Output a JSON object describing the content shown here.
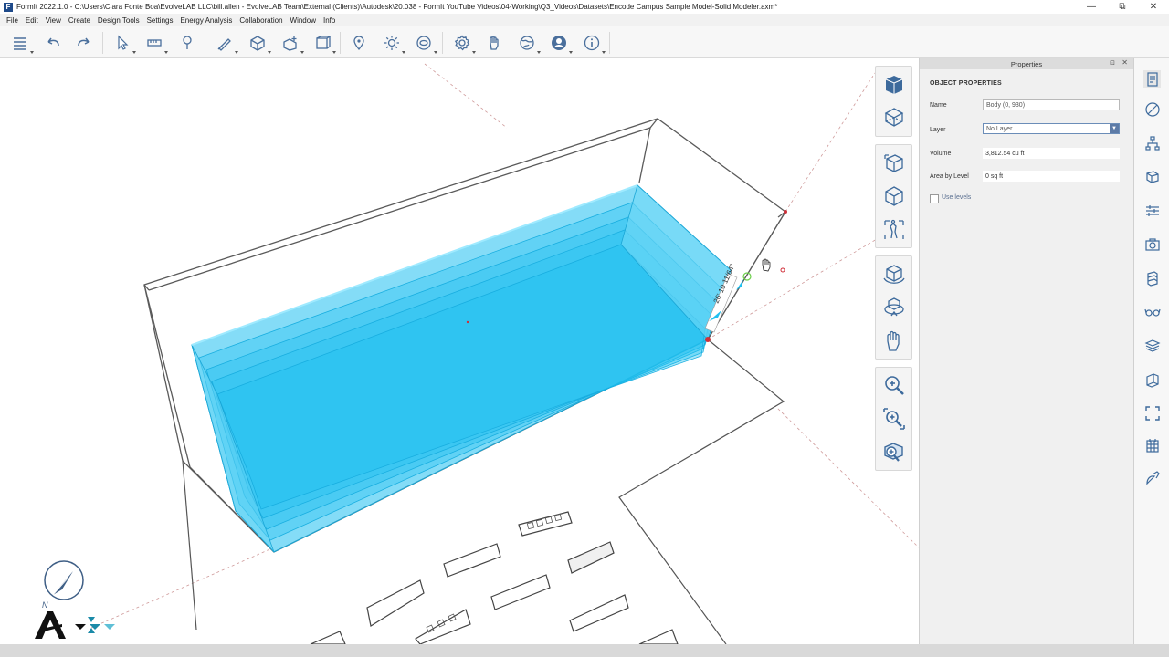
{
  "window": {
    "title": "FormIt 2022.1.0 - C:\\Users\\Clara Fonte Boa\\EvolveLAB LLC\\bill.allen - EvolveLAB Team\\External (Clients)\\Autodesk\\20.038 - FormIt YouTube Videos\\04-Working\\Q3_Videos\\Datasets\\Encode Campus Sample Model-Solid Modeler.axm*",
    "logo_letter": "F",
    "minimize_glyph": "—",
    "maximize_glyph": "⧉",
    "close_glyph": "✕"
  },
  "menu": [
    "File",
    "Edit",
    "View",
    "Create",
    "Design Tools",
    "Settings",
    "Energy Analysis",
    "Collaboration",
    "Window",
    "Info"
  ],
  "toolbar": {
    "icons": [
      "layers-icon",
      "undo-icon",
      "redo-icon",
      "select-icon",
      "measure-icon",
      "place-object-icon",
      "sketch-icon",
      "cube-icon",
      "solid-tools-icon",
      "array-icon",
      "location-icon",
      "sun-icon",
      "view-360-icon",
      "settings-icon",
      "gesture-icon",
      "globe-icon",
      "user-icon",
      "info-icon"
    ]
  },
  "scene": {
    "dimension_label": "26' 10 11/64\"",
    "accent_color": "#1fc0f0",
    "edge_color": "#555555"
  },
  "compass": {
    "north_label": "N"
  },
  "properties": {
    "header": "Properties",
    "pin_glyph": "⊡",
    "close_glyph": "✕",
    "section_title": "OBJECT PROPERTIES",
    "name_label": "Name",
    "name_value": "Body (0, 930)",
    "layer_label": "Layer",
    "layer_value": "No Layer",
    "volume_label": "Volume",
    "volume_value": "3,812.54 cu ft",
    "area_label": "Area by Level",
    "area_value": "0 sq ft",
    "use_levels_label": "Use levels"
  },
  "nav_cube": {
    "buttons": [
      "view-cube-front-icon",
      "wireframe-cube-icon",
      "perspective-cube-icon",
      "iso-cube-icon",
      "walk-icon",
      "orbit-icon",
      "look-around-icon",
      "pan-hand-icon",
      "zoom-icon",
      "zoom-window-icon",
      "zoom-extents-icon"
    ]
  },
  "right_panel_icons": [
    "properties-panel-icon",
    "materials-icon",
    "groups-tree-icon",
    "components-icon",
    "layers-panel-icon",
    "scenes-icon",
    "levels-icon",
    "visual-styles-icon",
    "stacked-layers-icon",
    "dynamo-icon",
    "fullscreen-icon",
    "calendar-grid-icon",
    "satellite-icon"
  ]
}
